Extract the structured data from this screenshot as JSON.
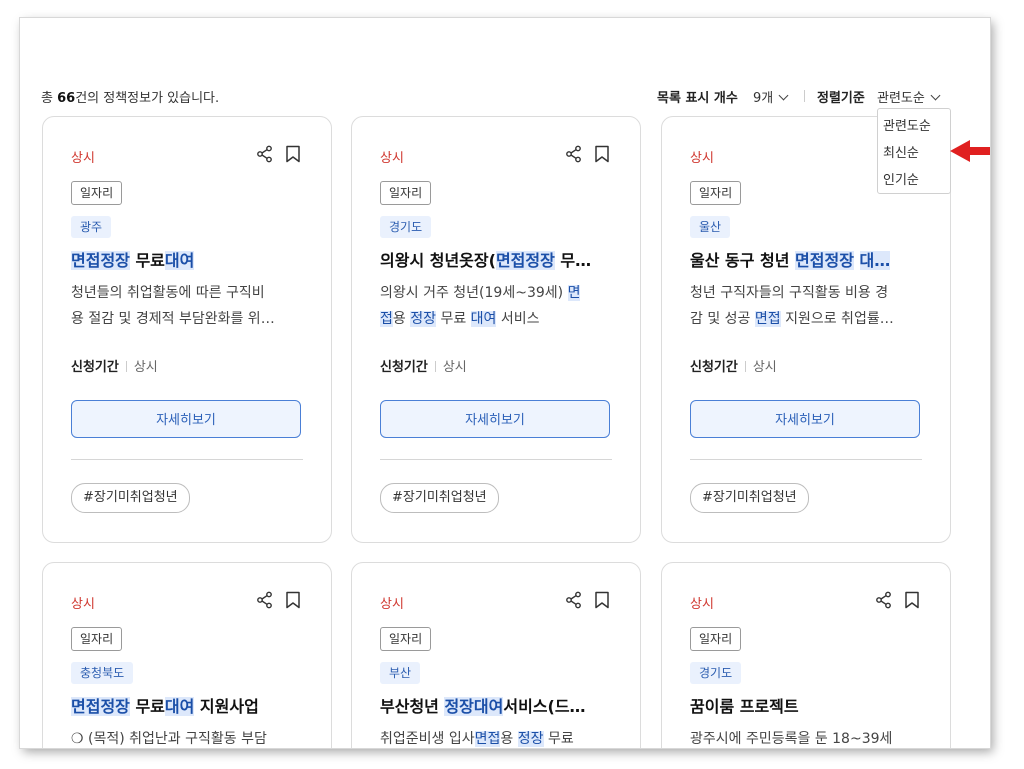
{
  "summary": {
    "prefix": "총 ",
    "count": "66",
    "suffix": "건의 정책정보가 있습니다."
  },
  "controls": {
    "page_size_label": "목록 표시 개수",
    "page_size_value": "9개",
    "sort_label": "정렬기준",
    "sort_value": "관련도순"
  },
  "sort_options": [
    "관련도순",
    "최신순",
    "인기순"
  ],
  "annotation": {
    "arrow_color": "#e02020",
    "points_to": "최신순"
  },
  "colors": {
    "status": "#d0372f",
    "accent": "#2a5fb8",
    "highlight_bg": "#dde8fb"
  },
  "cards": [
    {
      "status": "상시",
      "category": "일자리",
      "region": "광주",
      "title": [
        {
          "t": "면접정장",
          "h": true
        },
        {
          "t": " 무료",
          "h": false
        },
        {
          "t": "대여",
          "h": true
        }
      ],
      "desc": [
        [
          {
            "t": "청년들의 취업활동에 따른 구직비",
            "h": false
          }
        ],
        [
          {
            "t": "용 절감 및 경제적 부담완화를 위…",
            "h": false
          }
        ]
      ],
      "period_label": "신청기간",
      "period_value": "상시",
      "button": "자세히보기",
      "tag": "#장기미취업청년"
    },
    {
      "status": "상시",
      "category": "일자리",
      "region": "경기도",
      "title": [
        {
          "t": "의왕시 청년옷장(",
          "h": false
        },
        {
          "t": "면접정장",
          "h": true
        },
        {
          "t": " 무…",
          "h": false
        }
      ],
      "desc": [
        [
          {
            "t": "의왕시 거주 청년(19세~39세) ",
            "h": false
          },
          {
            "t": "면",
            "h": true
          }
        ],
        [
          {
            "t": "접",
            "h": true
          },
          {
            "t": "용 ",
            "h": false
          },
          {
            "t": "정장",
            "h": true
          },
          {
            "t": " 무료 ",
            "h": false
          },
          {
            "t": "대여",
            "h": true
          },
          {
            "t": " 서비스",
            "h": false
          }
        ]
      ],
      "period_label": "신청기간",
      "period_value": "상시",
      "button": "자세히보기",
      "tag": "#장기미취업청년"
    },
    {
      "status": "상시",
      "category": "일자리",
      "region": "울산",
      "title": [
        {
          "t": "울산 동구 청년 ",
          "h": false
        },
        {
          "t": "면접정장",
          "h": true
        },
        {
          "t": " ",
          "h": false
        },
        {
          "t": "대…",
          "h": true
        }
      ],
      "desc": [
        [
          {
            "t": "청년 구직자들의 구직활동 비용 경",
            "h": false
          }
        ],
        [
          {
            "t": "감 및 성공 ",
            "h": false
          },
          {
            "t": "면접",
            "h": true
          },
          {
            "t": " 지원으로 취업률…",
            "h": false
          }
        ]
      ],
      "period_label": "신청기간",
      "period_value": "상시",
      "button": "자세히보기",
      "tag": "#장기미취업청년"
    },
    {
      "status": "상시",
      "category": "일자리",
      "region": "충청북도",
      "title": [
        {
          "t": "면접정장",
          "h": true
        },
        {
          "t": " 무료",
          "h": false
        },
        {
          "t": "대여",
          "h": true
        },
        {
          "t": " 지원사업",
          "h": false
        }
      ],
      "desc": [
        [
          {
            "t": "❍ (목적) 취업난과 구직활동 부담",
            "h": false
          }
        ]
      ]
    },
    {
      "status": "상시",
      "category": "일자리",
      "region": "부산",
      "title": [
        {
          "t": "부산청년 ",
          "h": false
        },
        {
          "t": "정장대여",
          "h": true
        },
        {
          "t": "서비스(드…",
          "h": false
        }
      ],
      "desc": [
        [
          {
            "t": "취업준비생 입사",
            "h": false
          },
          {
            "t": "면접",
            "h": true
          },
          {
            "t": "용 ",
            "h": false
          },
          {
            "t": "정장",
            "h": true
          },
          {
            "t": " 무료",
            "h": false
          }
        ]
      ]
    },
    {
      "status": "상시",
      "category": "일자리",
      "region": "경기도",
      "title": [
        {
          "t": "꿈이룸 프로젝트",
          "h": false
        }
      ],
      "desc": [
        [
          {
            "t": "광주시에 주민등록을 둔 18~39세",
            "h": false
          }
        ]
      ]
    }
  ]
}
